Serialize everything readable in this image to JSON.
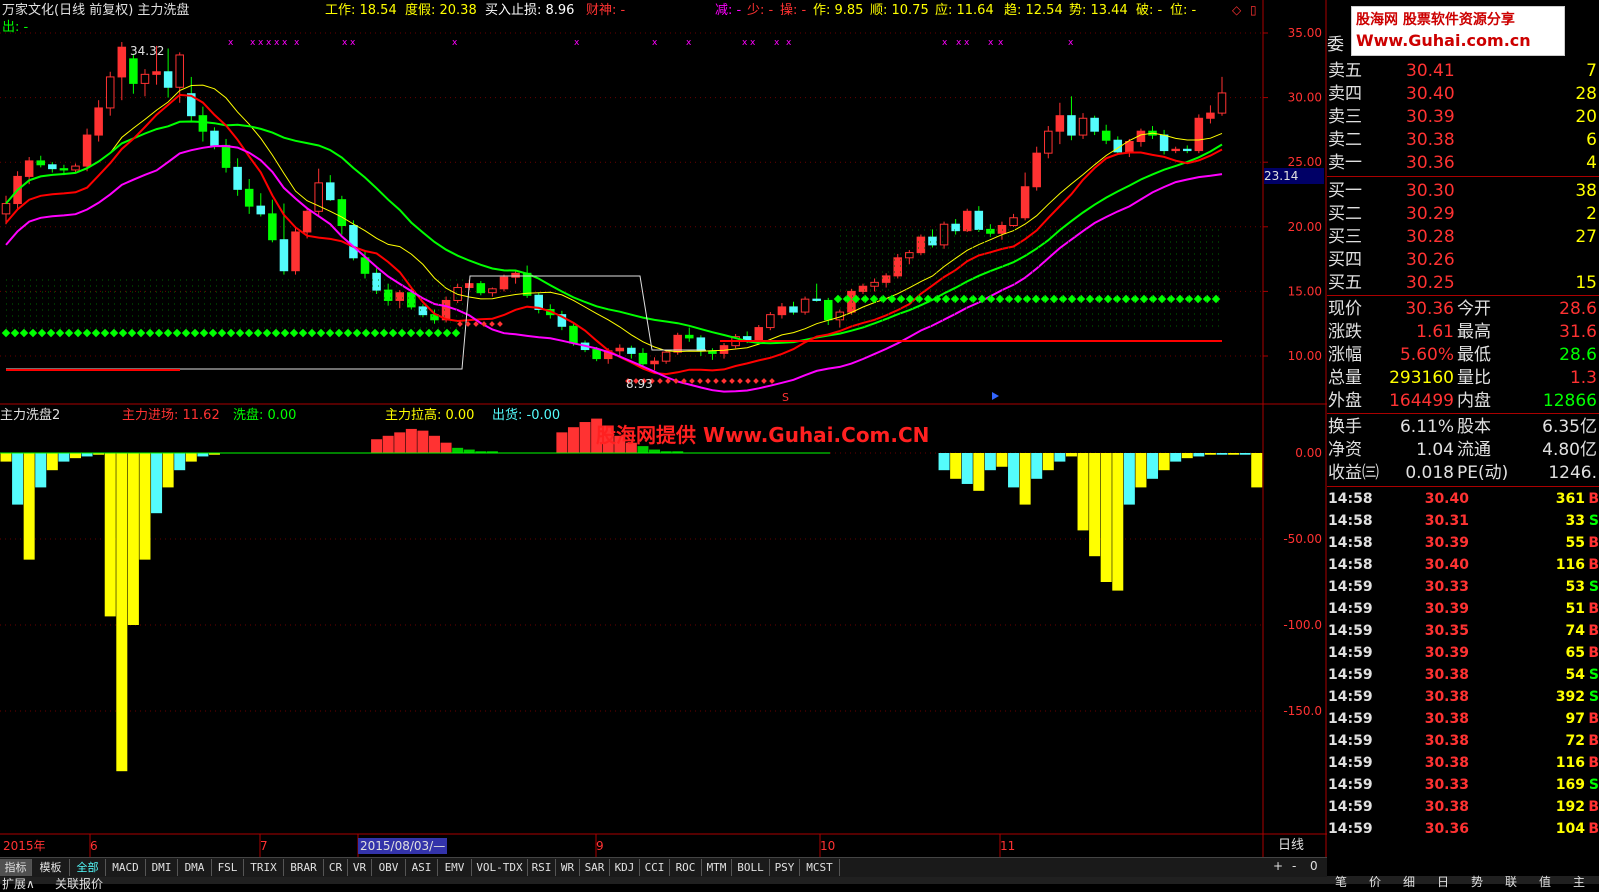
{
  "header": {
    "title": "万家文化(日线 前复权) 主力洗盘",
    "out_label": "出: -",
    "work": "工作: 18.54",
    "duojia": "度假: 20.38",
    "stoploss": "买入止损: 8.96",
    "caishen": "财神: -",
    "jian": "减: -",
    "shao": "少: -",
    "cao": "操: -",
    "zuo": "作: 9.85",
    "shun": "顺: 10.75",
    "ying": "应: 11.64",
    "qu": "趋: 12.54",
    "shi": "势: 13.44",
    "po": "破: -",
    "wei": "位: -"
  },
  "main_chart": {
    "y_ticks": [
      "35.00",
      "30.00",
      "25.00",
      "20.00",
      "15.00",
      "10.00"
    ],
    "high_marker": "34.32",
    "low_marker": "8.93",
    "current_price_tag": "23.14",
    "s_marker": "S"
  },
  "indicator": {
    "name": "主力洗盘2",
    "jinchang": "主力进场: 11.62",
    "xipan": "洗盘: 0.00",
    "lagao": "主力拉高: 0.00",
    "chuhuo": "出货: -0.00",
    "y_ticks": [
      "0.00",
      "-50.00",
      "-100.0",
      "-150.0"
    ],
    "watermark": "股海网提供 Www.Guhai.Com.CN"
  },
  "time_axis": {
    "labels": [
      "2015年",
      "6",
      "7",
      "2015/08/03/—",
      "9",
      "10",
      "11"
    ],
    "period": "日线"
  },
  "tabs": [
    "指标",
    "模板",
    "全部",
    "MACD",
    "DMI",
    "DMA",
    "FSL",
    "TRIX",
    "BRAR",
    "CR",
    "VR",
    "OBV",
    "ASI",
    "EMV",
    "VOL-TDX",
    "RSI",
    "WR",
    "SAR",
    "KDJ",
    "CCI",
    "ROC",
    "MTM",
    "BOLL",
    "PSY",
    "MCST"
  ],
  "bottom_tabs": [
    "扩展∧",
    "关联报价"
  ],
  "zoom_controls": [
    "+",
    "-",
    "0"
  ],
  "logo": {
    "top": "股海网 股票软件资源分享",
    "bottom": "Www.Guhai.com.cn"
  },
  "quote": {
    "wei_label": "委",
    "asks": [
      {
        "label": "卖五",
        "price": "30.41",
        "vol": "7"
      },
      {
        "label": "卖四",
        "price": "30.40",
        "vol": "28"
      },
      {
        "label": "卖三",
        "price": "30.39",
        "vol": "20"
      },
      {
        "label": "卖二",
        "price": "30.38",
        "vol": "6"
      },
      {
        "label": "卖一",
        "price": "30.36",
        "vol": "4"
      }
    ],
    "bids": [
      {
        "label": "买一",
        "price": "30.30",
        "vol": "38"
      },
      {
        "label": "买二",
        "price": "30.29",
        "vol": "2"
      },
      {
        "label": "买三",
        "price": "30.28",
        "vol": "27"
      },
      {
        "label": "买四",
        "price": "30.26",
        "vol": ""
      },
      {
        "label": "买五",
        "price": "30.25",
        "vol": "15"
      }
    ],
    "stats": [
      {
        "l1": "现价",
        "v1": "30.36",
        "l2": "今开",
        "v2": "28.6"
      },
      {
        "l1": "涨跌",
        "v1": "1.61",
        "l2": "最高",
        "v2": "31.6"
      },
      {
        "l1": "涨幅",
        "v1": "5.60%",
        "l2": "最低",
        "v2": "28.6"
      },
      {
        "l1": "总量",
        "v1": "293160",
        "l2": "量比",
        "v2": "1.3"
      },
      {
        "l1": "外盘",
        "v1": "164499",
        "l2": "内盘",
        "v2": "12866"
      }
    ],
    "stats2": [
      {
        "l1": "换手",
        "v1": "6.11%",
        "l2": "股本",
        "v2": "6.35亿"
      },
      {
        "l1": "净资",
        "v1": "1.04",
        "l2": "流通",
        "v2": "4.80亿"
      },
      {
        "l1": "收益㈢",
        "v1": "0.018",
        "l2": "PE(动)",
        "v2": "1246."
      }
    ],
    "ticks": [
      {
        "t": "14:58",
        "p": "30.40",
        "v": "361",
        "d": "B"
      },
      {
        "t": "14:58",
        "p": "30.31",
        "v": "33",
        "d": "S"
      },
      {
        "t": "14:58",
        "p": "30.39",
        "v": "55",
        "d": "B"
      },
      {
        "t": "14:58",
        "p": "30.40",
        "v": "116",
        "d": "B"
      },
      {
        "t": "14:59",
        "p": "30.33",
        "v": "53",
        "d": "S"
      },
      {
        "t": "14:59",
        "p": "30.39",
        "v": "51",
        "d": "B"
      },
      {
        "t": "14:59",
        "p": "30.35",
        "v": "74",
        "d": "B"
      },
      {
        "t": "14:59",
        "p": "30.39",
        "v": "65",
        "d": "B"
      },
      {
        "t": "14:59",
        "p": "30.38",
        "v": "54",
        "d": "S"
      },
      {
        "t": "14:59",
        "p": "30.38",
        "v": "392",
        "d": "S"
      },
      {
        "t": "14:59",
        "p": "30.38",
        "v": "97",
        "d": "B"
      },
      {
        "t": "14:59",
        "p": "30.38",
        "v": "72",
        "d": "B"
      },
      {
        "t": "14:59",
        "p": "30.38",
        "v": "116",
        "d": "B"
      },
      {
        "t": "14:59",
        "p": "30.33",
        "v": "169",
        "d": "S"
      },
      {
        "t": "14:59",
        "p": "30.38",
        "v": "192",
        "d": "B"
      },
      {
        "t": "14:59",
        "p": "30.36",
        "v": "104",
        "d": "B"
      }
    ],
    "bottom_tabs": [
      "笔",
      "价",
      "细",
      "日",
      "势",
      "联",
      "值",
      "主"
    ]
  },
  "colors": {
    "up": "#ff3232",
    "down": "#54fcfc",
    "green": "#00ff00",
    "yellow": "#ffff00",
    "magenta": "#ff00ff"
  },
  "chart_data": [
    {
      "type": "candlestick",
      "ylim": [
        8,
        36
      ],
      "candles": [
        [
          21,
          22.4,
          20.2,
          21.8
        ],
        [
          21.8,
          24.3,
          21.4,
          23.9
        ],
        [
          23.9,
          25.4,
          23.3,
          25.1
        ],
        [
          25.1,
          25.5,
          24.6,
          24.8
        ],
        [
          24.8,
          25.0,
          24.2,
          24.5
        ],
        [
          24.5,
          24.8,
          24.0,
          24.4
        ],
        [
          24.4,
          24.9,
          24.2,
          24.7
        ],
        [
          24.7,
          27.6,
          24.3,
          27.1
        ],
        [
          27.1,
          29.8,
          26.6,
          29.2
        ],
        [
          29.2,
          32.0,
          28.6,
          31.6
        ],
        [
          31.6,
          34.3,
          29.8,
          33.9
        ],
        [
          33.0,
          33.4,
          30.3,
          31.1
        ],
        [
          31.1,
          32.2,
          30.1,
          31.8
        ],
        [
          31.8,
          34.0,
          31.0,
          32.0
        ],
        [
          32.0,
          33.8,
          30.0,
          30.8
        ],
        [
          30.8,
          33.5,
          29.6,
          33.3
        ],
        [
          30.3,
          31.6,
          28.1,
          28.6
        ],
        [
          28.6,
          29.3,
          26.6,
          27.4
        ],
        [
          27.4,
          27.7,
          26.0,
          26.3
        ],
        [
          26.3,
          26.8,
          24.2,
          24.6
        ],
        [
          24.6,
          25.3,
          22.4,
          22.9
        ],
        [
          22.9,
          23.7,
          21.0,
          21.6
        ],
        [
          21.6,
          22.6,
          20.8,
          21.0
        ],
        [
          21.0,
          22.1,
          18.8,
          19.0
        ],
        [
          19.0,
          21.8,
          16.3,
          16.6
        ],
        [
          16.6,
          20.0,
          16.3,
          19.6
        ],
        [
          19.6,
          21.5,
          19.1,
          21.2
        ],
        [
          21.2,
          24.5,
          20.8,
          23.4
        ],
        [
          23.4,
          24.0,
          22.0,
          22.1
        ],
        [
          22.1,
          22.4,
          19.4,
          20.1
        ],
        [
          20.1,
          20.5,
          17.4,
          17.6
        ],
        [
          17.6,
          18.1,
          16.0,
          16.4
        ],
        [
          16.4,
          16.8,
          14.8,
          15.1
        ],
        [
          15.1,
          15.6,
          13.9,
          14.3
        ],
        [
          14.3,
          15.1,
          13.7,
          14.9
        ],
        [
          14.9,
          15.2,
          13.6,
          13.8
        ],
        [
          13.8,
          14.0,
          13.0,
          13.2
        ],
        [
          13.2,
          13.6,
          12.5,
          12.8
        ],
        [
          12.8,
          14.6,
          12.6,
          14.3
        ],
        [
          14.3,
          15.6,
          14.1,
          15.3
        ],
        [
          15.3,
          15.9,
          15.1,
          15.6
        ],
        [
          15.6,
          15.8,
          14.7,
          14.9
        ],
        [
          14.9,
          15.3,
          14.6,
          15.2
        ],
        [
          15.2,
          16.3,
          15.0,
          16.1
        ],
        [
          16.1,
          16.6,
          15.6,
          16.4
        ],
        [
          16.4,
          17.0,
          14.5,
          14.7
        ],
        [
          14.7,
          14.9,
          13.3,
          13.6
        ],
        [
          13.6,
          14.0,
          12.9,
          13.2
        ],
        [
          13.2,
          13.5,
          12.0,
          12.3
        ],
        [
          12.3,
          12.5,
          10.8,
          11.0
        ],
        [
          11.0,
          11.2,
          10.3,
          10.5
        ],
        [
          10.5,
          10.7,
          9.6,
          9.8
        ],
        [
          9.8,
          10.6,
          9.4,
          10.4
        ],
        [
          10.4,
          10.9,
          10.0,
          10.6
        ],
        [
          10.6,
          10.8,
          9.8,
          10.2
        ],
        [
          10.2,
          10.6,
          9.0,
          9.4
        ],
        [
          9.4,
          9.9,
          8.9,
          9.6
        ],
        [
          9.6,
          10.5,
          9.4,
          10.3
        ],
        [
          10.3,
          11.8,
          10.1,
          11.6
        ],
        [
          11.6,
          12.2,
          11.1,
          11.4
        ],
        [
          11.4,
          11.6,
          10.0,
          10.4
        ],
        [
          10.4,
          10.6,
          9.7,
          10.2
        ],
        [
          10.2,
          11.0,
          9.8,
          10.8
        ],
        [
          10.8,
          11.7,
          10.6,
          11.5
        ],
        [
          11.5,
          11.9,
          11.0,
          11.2
        ],
        [
          11.2,
          12.4,
          11.0,
          12.2
        ],
        [
          12.2,
          13.4,
          12.0,
          13.2
        ],
        [
          13.2,
          14.1,
          12.9,
          13.8
        ],
        [
          13.8,
          14.2,
          13.2,
          13.4
        ],
        [
          13.4,
          14.6,
          13.2,
          14.4
        ],
        [
          14.4,
          15.6,
          14.2,
          14.3
        ],
        [
          14.3,
          14.5,
          12.4,
          12.8
        ],
        [
          12.8,
          13.6,
          12.2,
          13.4
        ],
        [
          13.4,
          15.2,
          13.2,
          15.0
        ],
        [
          15.0,
          15.6,
          14.8,
          15.4
        ],
        [
          15.4,
          16.0,
          15.0,
          15.7
        ],
        [
          15.7,
          16.4,
          15.3,
          16.2
        ],
        [
          16.2,
          17.9,
          16.0,
          17.6
        ],
        [
          17.6,
          18.2,
          17.1,
          18.0
        ],
        [
          18.0,
          19.4,
          17.8,
          19.2
        ],
        [
          19.2,
          19.8,
          18.4,
          18.6
        ],
        [
          18.6,
          20.4,
          18.3,
          20.2
        ],
        [
          20.2,
          20.6,
          19.4,
          19.7
        ],
        [
          19.7,
          21.4,
          19.6,
          21.2
        ],
        [
          21.2,
          21.6,
          19.6,
          19.8
        ],
        [
          19.8,
          20.2,
          19.2,
          19.5
        ],
        [
          19.5,
          20.4,
          19.0,
          20.1
        ],
        [
          20.1,
          21.0,
          20.0,
          20.7
        ],
        [
          20.7,
          24.2,
          20.5,
          23.1
        ],
        [
          23.1,
          26.2,
          22.8,
          25.7
        ],
        [
          25.7,
          27.8,
          25.3,
          27.4
        ],
        [
          27.4,
          29.6,
          26.4,
          28.6
        ],
        [
          28.6,
          30.1,
          26.7,
          27.1
        ],
        [
          27.1,
          28.8,
          26.8,
          28.4
        ],
        [
          28.4,
          28.6,
          27.1,
          27.4
        ],
        [
          27.4,
          27.9,
          26.4,
          26.7
        ],
        [
          26.7,
          27.0,
          25.6,
          25.8
        ],
        [
          25.8,
          26.8,
          25.4,
          26.6
        ],
        [
          26.6,
          27.6,
          26.2,
          27.4
        ],
        [
          27.4,
          27.8,
          26.8,
          27.1
        ],
        [
          27.1,
          27.5,
          25.6,
          25.9
        ],
        [
          25.9,
          26.2,
          25.7,
          26.0
        ],
        [
          26.0,
          26.3,
          25.7,
          25.9
        ],
        [
          25.9,
          28.7,
          25.7,
          28.4
        ],
        [
          28.4,
          29.4,
          28.0,
          28.8
        ],
        [
          28.8,
          31.6,
          28.6,
          30.36
        ]
      ]
    },
    {
      "type": "bar",
      "ylim": [
        -190,
        15
      ],
      "series": [
        {
          "name": "主力进场",
          "values": [
            0,
            0,
            0,
            0,
            0,
            0,
            0,
            0,
            0,
            0,
            0,
            0,
            0,
            0,
            0,
            0,
            0,
            0,
            0,
            0,
            0,
            0,
            0,
            0,
            0,
            0,
            0,
            0,
            0,
            0,
            0,
            0,
            0,
            0,
            0,
            0,
            0,
            0,
            0,
            0,
            0,
            0,
            0,
            0,
            0,
            0,
            0,
            0,
            0,
            0,
            0,
            0,
            0,
            0,
            0,
            0,
            0,
            0,
            0,
            0,
            0,
            0,
            0,
            0,
            0,
            0,
            0,
            0,
            0,
            0,
            0,
            0,
            0,
            0,
            0,
            0,
            0,
            0,
            0,
            0,
            0,
            0,
            0,
            0,
            0,
            0,
            0,
            0,
            0,
            0,
            0,
            0,
            0,
            0,
            0,
            0,
            0,
            0,
            0,
            0,
            0,
            0,
            0,
            0,
            0,
            0,
            0,
            0,
            0,
            0
          ]
        },
        {
          "name": "洗盘",
          "values": [
            -5,
            -30,
            -62,
            -20,
            -10,
            -5,
            -3,
            -2,
            -1,
            -95,
            -185,
            -100,
            -62,
            -35,
            -20,
            -10,
            -5,
            -2,
            -1,
            0,
            0,
            0,
            0,
            0,
            0,
            0,
            0,
            0,
            0,
            0,
            0,
            0,
            0,
            0,
            0,
            0,
            0,
            0,
            0,
            0,
            0,
            0,
            0,
            0,
            0,
            0,
            0,
            0,
            0,
            0,
            0,
            0,
            0,
            0,
            0,
            0,
            0,
            0,
            0,
            0,
            0,
            0,
            0,
            0,
            0,
            0,
            0,
            0,
            0,
            0,
            0,
            0,
            0,
            0,
            0,
            0,
            0,
            0,
            0,
            0,
            0,
            -10,
            -15,
            -18,
            -22,
            -10,
            -8,
            -20,
            -30,
            -15,
            -10,
            -5,
            -2,
            -45,
            -60,
            -75,
            -80,
            -30,
            -20,
            -15,
            -10,
            -5,
            -3,
            -2,
            -1,
            -1,
            -1,
            -1,
            -20,
            0
          ]
        },
        {
          "name": "主力拉高",
          "values": [
            0,
            0,
            0,
            0,
            0,
            0,
            0,
            0,
            0,
            0,
            0,
            0,
            0,
            0,
            0,
            0,
            0,
            0,
            0,
            0,
            0,
            0,
            0,
            0,
            0,
            0,
            0,
            0,
            0,
            0,
            0,
            0,
            8,
            10,
            12,
            14,
            13,
            10,
            6,
            3,
            2,
            1,
            1,
            0,
            0,
            0,
            0,
            0,
            12,
            15,
            18,
            20,
            16,
            10,
            6,
            4,
            2,
            1,
            1,
            0,
            0,
            0,
            0,
            0,
            0,
            0,
            0,
            0,
            0,
            0,
            0,
            0,
            0,
            0,
            0,
            0,
            0,
            0,
            0,
            0,
            0,
            0,
            0,
            0,
            0,
            0,
            0,
            0,
            0,
            0,
            0,
            0,
            0,
            0,
            0,
            0,
            0,
            0,
            0,
            0,
            0,
            0,
            0,
            0,
            0,
            0,
            0,
            0,
            0,
            0
          ]
        }
      ]
    }
  ]
}
